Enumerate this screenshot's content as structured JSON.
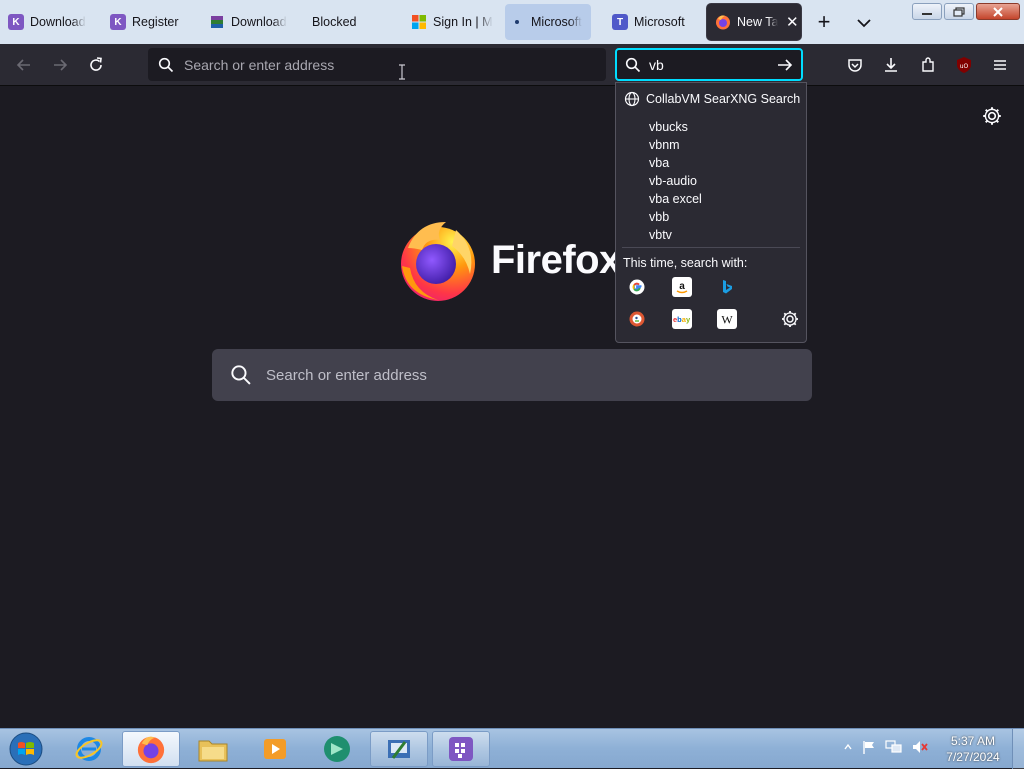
{
  "browser": {
    "tabs": [
      {
        "label": "Download",
        "favicon": "kaboom-icon"
      },
      {
        "label": "Register",
        "favicon": "kaboom-icon"
      },
      {
        "label": "Download",
        "favicon": "winrar-icon"
      },
      {
        "label": "Blocked",
        "favicon": "none"
      },
      {
        "label": "Sign In | M",
        "favicon": "microsoft-icon"
      },
      {
        "label": "Microsoft",
        "favicon": "media-dot-icon"
      },
      {
        "label": "Microsoft",
        "favicon": "teams-icon"
      },
      {
        "label": "New Tab",
        "favicon": "firefox-icon",
        "active": true
      }
    ],
    "new_tab_label": "+",
    "url_placeholder": "Search or enter address",
    "search_value": "vb",
    "search_popup": {
      "engine_label": "CollabVM SearXNG Search",
      "suggestions": [
        "vbucks",
        "vbnm",
        "vba",
        "vb-audio",
        "vba excel",
        "vbb",
        "vbtv"
      ],
      "search_with_label": "This time, search with:",
      "engines": [
        "google-icon",
        "amazon-icon",
        "bing-icon",
        "duckduckgo-icon",
        "ebay-icon",
        "wikipedia-icon"
      ]
    }
  },
  "content": {
    "wordmark": "Firefox",
    "search_placeholder": "Search or enter address"
  },
  "taskbar": {
    "time": "5:37 AM",
    "date": "7/27/2024"
  },
  "colors": {
    "content_bg": "#1c1b22",
    "toolbar_bg": "#2b2a33",
    "focus_ring": "#00ddff",
    "tabstrip_bg": "#d9e4f1"
  }
}
